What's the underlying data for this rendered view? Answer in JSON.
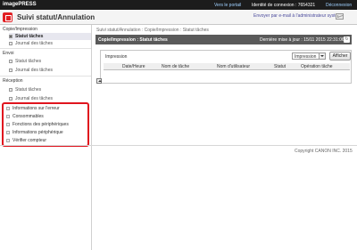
{
  "header": {
    "brand": "imagePRESS",
    "portal_link": "Vers le portail",
    "login_id": "Identité de connexion : 7654321",
    "logout_link": "Déconnexion"
  },
  "title_bar": {
    "title": "Suivi statut/Annulation",
    "email_link": "Envoyer par e-mail à l'administrateur système"
  },
  "sidebar": {
    "groups": [
      {
        "label": "Copie/Impression",
        "items": [
          {
            "label": "Statut tâches",
            "active": true
          },
          {
            "label": "Journal des tâches",
            "active": false
          }
        ]
      },
      {
        "label": "Envoi",
        "items": [
          {
            "label": "Statut tâches",
            "active": false
          },
          {
            "label": "Journal des tâches",
            "active": false
          }
        ]
      },
      {
        "label": "Réception",
        "items": [
          {
            "label": "Statut tâches",
            "active": false
          },
          {
            "label": "Journal des tâches",
            "active": false
          }
        ]
      }
    ],
    "other_items": [
      "Informations sur l'erreur",
      "Consommables",
      "Fonctions des périphériques",
      "Informations périphérique",
      "Vérifier compteur"
    ]
  },
  "main": {
    "breadcrumb": "Suivi statut/Annulation : Copie/Impression : Statut tâches",
    "panel_title": "Copie/Impression : Statut tâches",
    "last_update": "Dernière mise à jour : 15/11 2015 22:31:06",
    "section_label": "Impression",
    "filter_selected": "Impression",
    "apply_label": "Afficher",
    "columns": [
      "Date/Heure",
      "Nom de tâche",
      "Nom d'utilisateur",
      "Statut",
      "Opération tâche"
    ]
  },
  "footer": {
    "copyright": "Copyright CANON INC. 2015"
  },
  "colors": {
    "topbar": "#1c1c1c",
    "accent": "#e21f23",
    "link": "#4a4a9c",
    "panel_header": "#5a5a5a",
    "highlight_border": "#e0141e"
  }
}
